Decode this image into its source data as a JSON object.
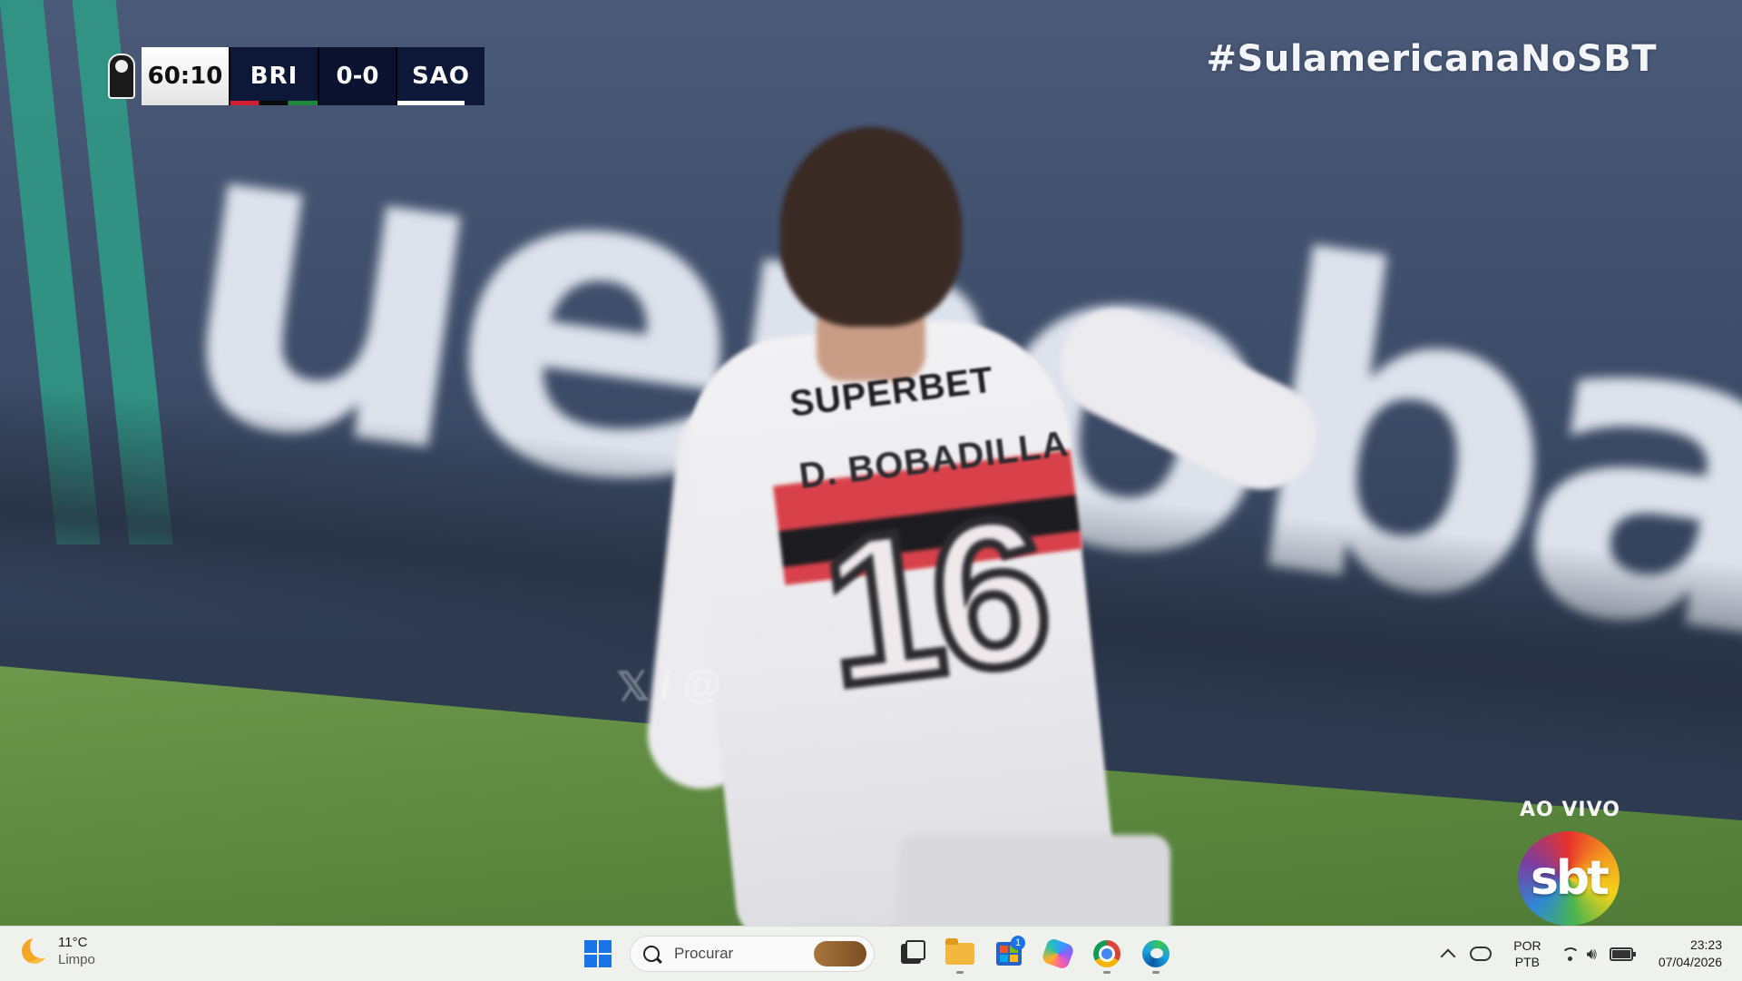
{
  "broadcast": {
    "clock": "60:10",
    "home_team": "BRI",
    "score": "0-0",
    "away_team": "SAO",
    "hashtag": "#SulamericanaNoSBT",
    "live_label": "AO VIVO",
    "channel_logo": "sbt"
  },
  "scene": {
    "board_text": "uenobank",
    "jersey_sponsor": "SUPERBET",
    "player_name": "D. BOBADILLA",
    "player_number": "16",
    "watermark": "/ @"
  },
  "taskbar": {
    "weather": {
      "temp": "11°C",
      "condition": "Limpo",
      "icon": "moon-icon"
    },
    "search": {
      "placeholder": "Procurar"
    },
    "apps": [
      {
        "name": "task-view",
        "icon": "task-view-icon"
      },
      {
        "name": "file-explorer",
        "icon": "folder-icon"
      },
      {
        "name": "microsoft-store",
        "icon": "store-icon",
        "badge": "1"
      },
      {
        "name": "copilot",
        "icon": "copilot-icon"
      },
      {
        "name": "chrome",
        "icon": "chrome-icon"
      },
      {
        "name": "edge",
        "icon": "edge-icon"
      }
    ],
    "tray": {
      "lang_line1": "POR",
      "lang_line2": "PTB",
      "time": "23:23",
      "date": "07/04/2026"
    }
  },
  "colors": {
    "scoreboard_dark": "#0d1838",
    "taskbar_bg": "#eef1ec",
    "windows_blue": "#1a73e8"
  }
}
